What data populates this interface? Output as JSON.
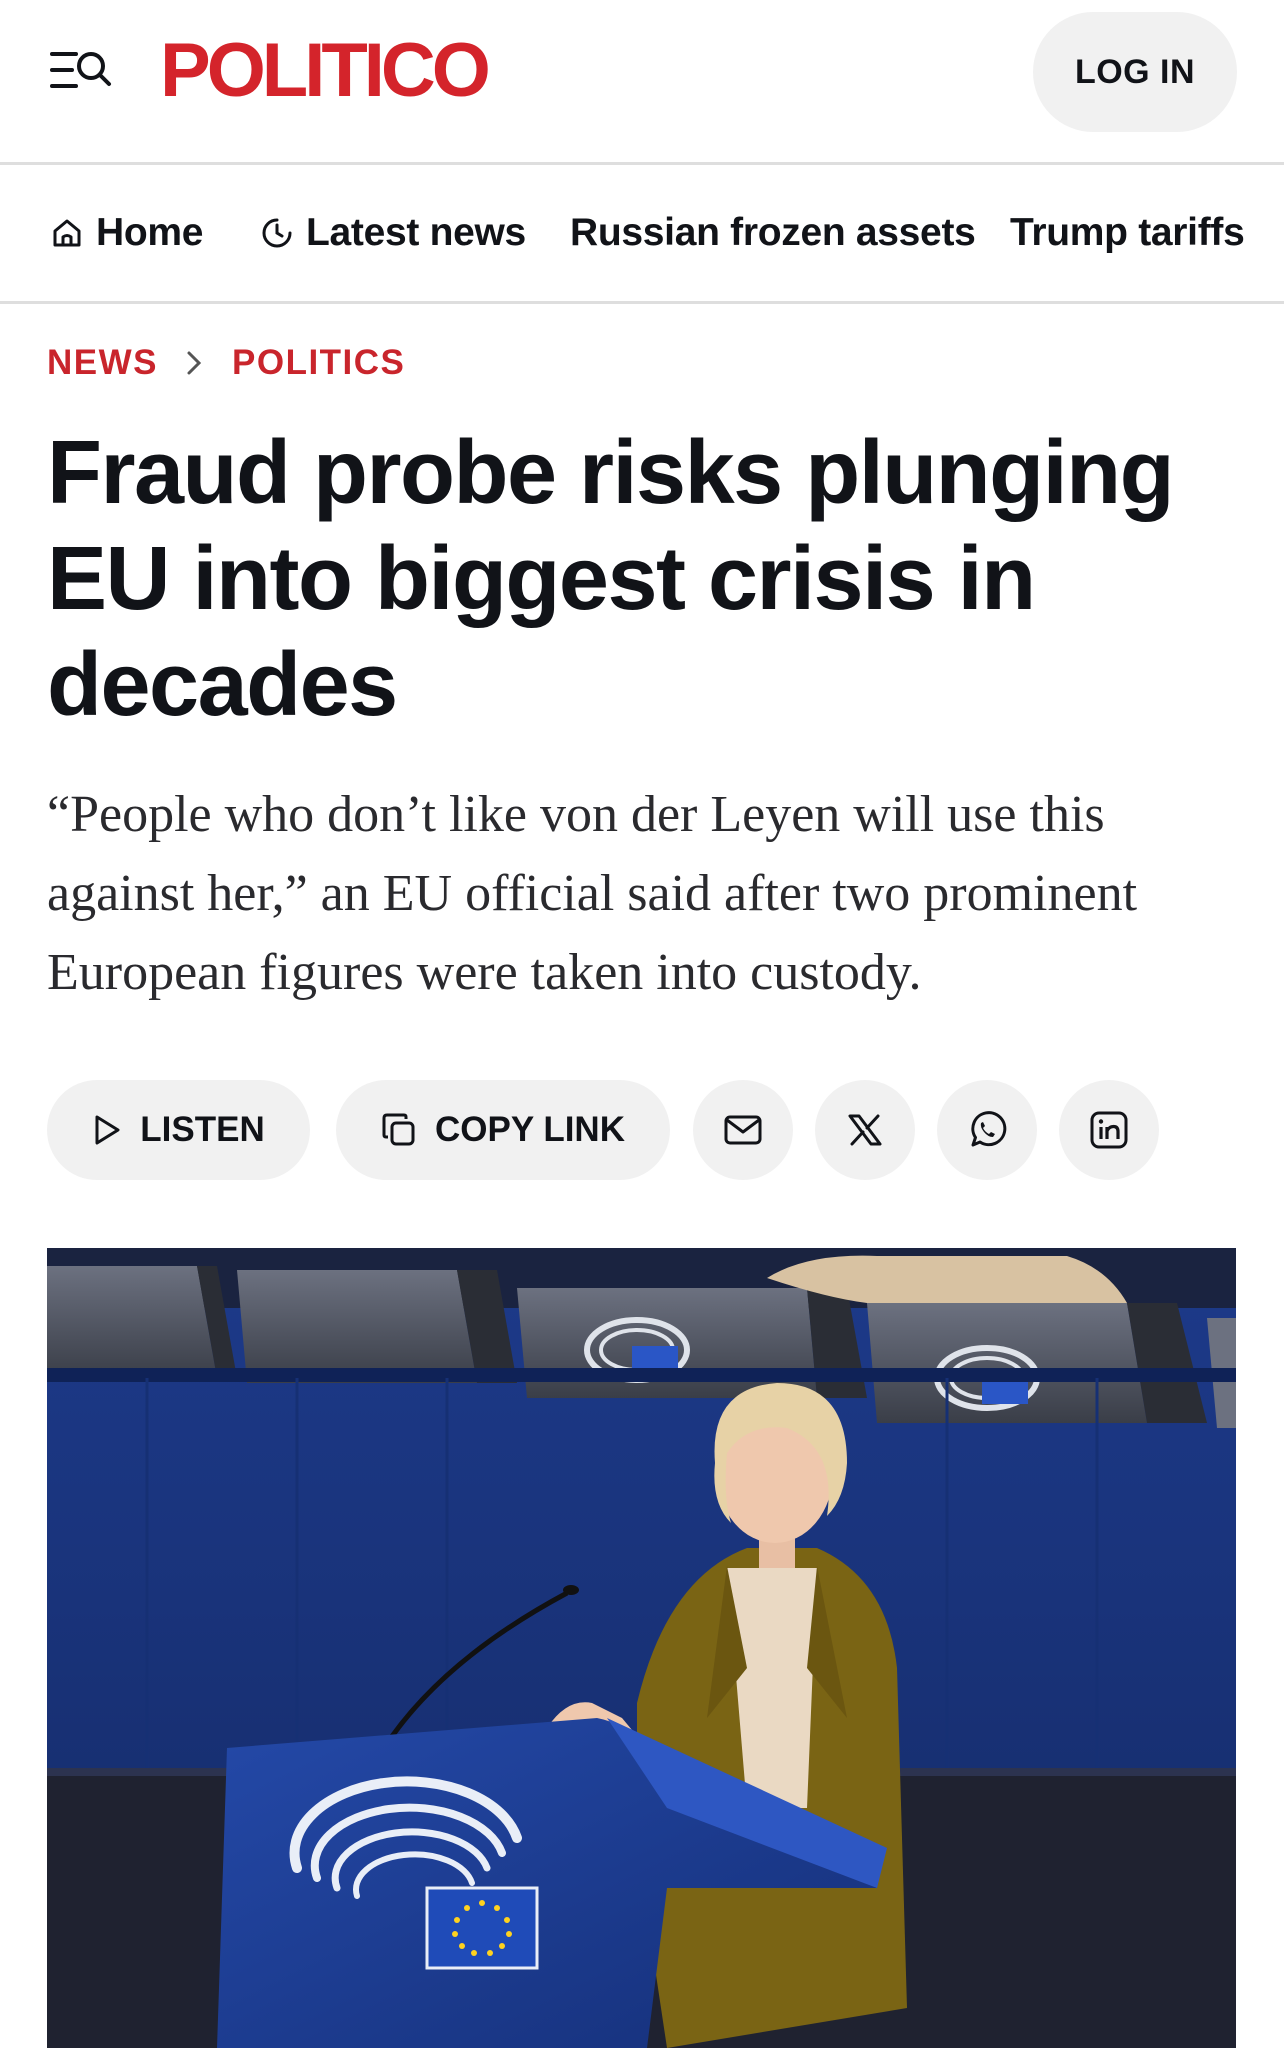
{
  "header": {
    "logo_text": "POLITICO",
    "login_label": "LOG IN",
    "icons": {
      "menu": "menu-search-icon"
    },
    "colors": {
      "brand_red": "#d4242b"
    }
  },
  "nav": {
    "items": [
      {
        "label": "Home",
        "icon": "home-icon"
      },
      {
        "label": "Latest news",
        "icon": "clock-icon"
      },
      {
        "label": "Russian frozen assets"
      },
      {
        "label": "Trump tariffs"
      }
    ]
  },
  "breadcrumb": {
    "items": [
      "NEWS",
      "POLITICS"
    ],
    "separator_icon": "chevron-right-icon",
    "color": "#c9252c"
  },
  "article": {
    "headline": "Fraud probe risks plunging EU into biggest crisis in decades",
    "dek": "“People who don’t like von der Leyen will use this against her,” an EU official said after two prominent European figures were taken into custody."
  },
  "share": {
    "listen_label": "LISTEN",
    "copy_link_label": "COPY LINK",
    "icons": [
      "play-icon",
      "copy-icon",
      "mail-icon",
      "x-icon",
      "whatsapp-icon",
      "linkedin-icon"
    ]
  },
  "photo": {
    "subject": "speaker-at-eu-parliament-podium-photo"
  }
}
